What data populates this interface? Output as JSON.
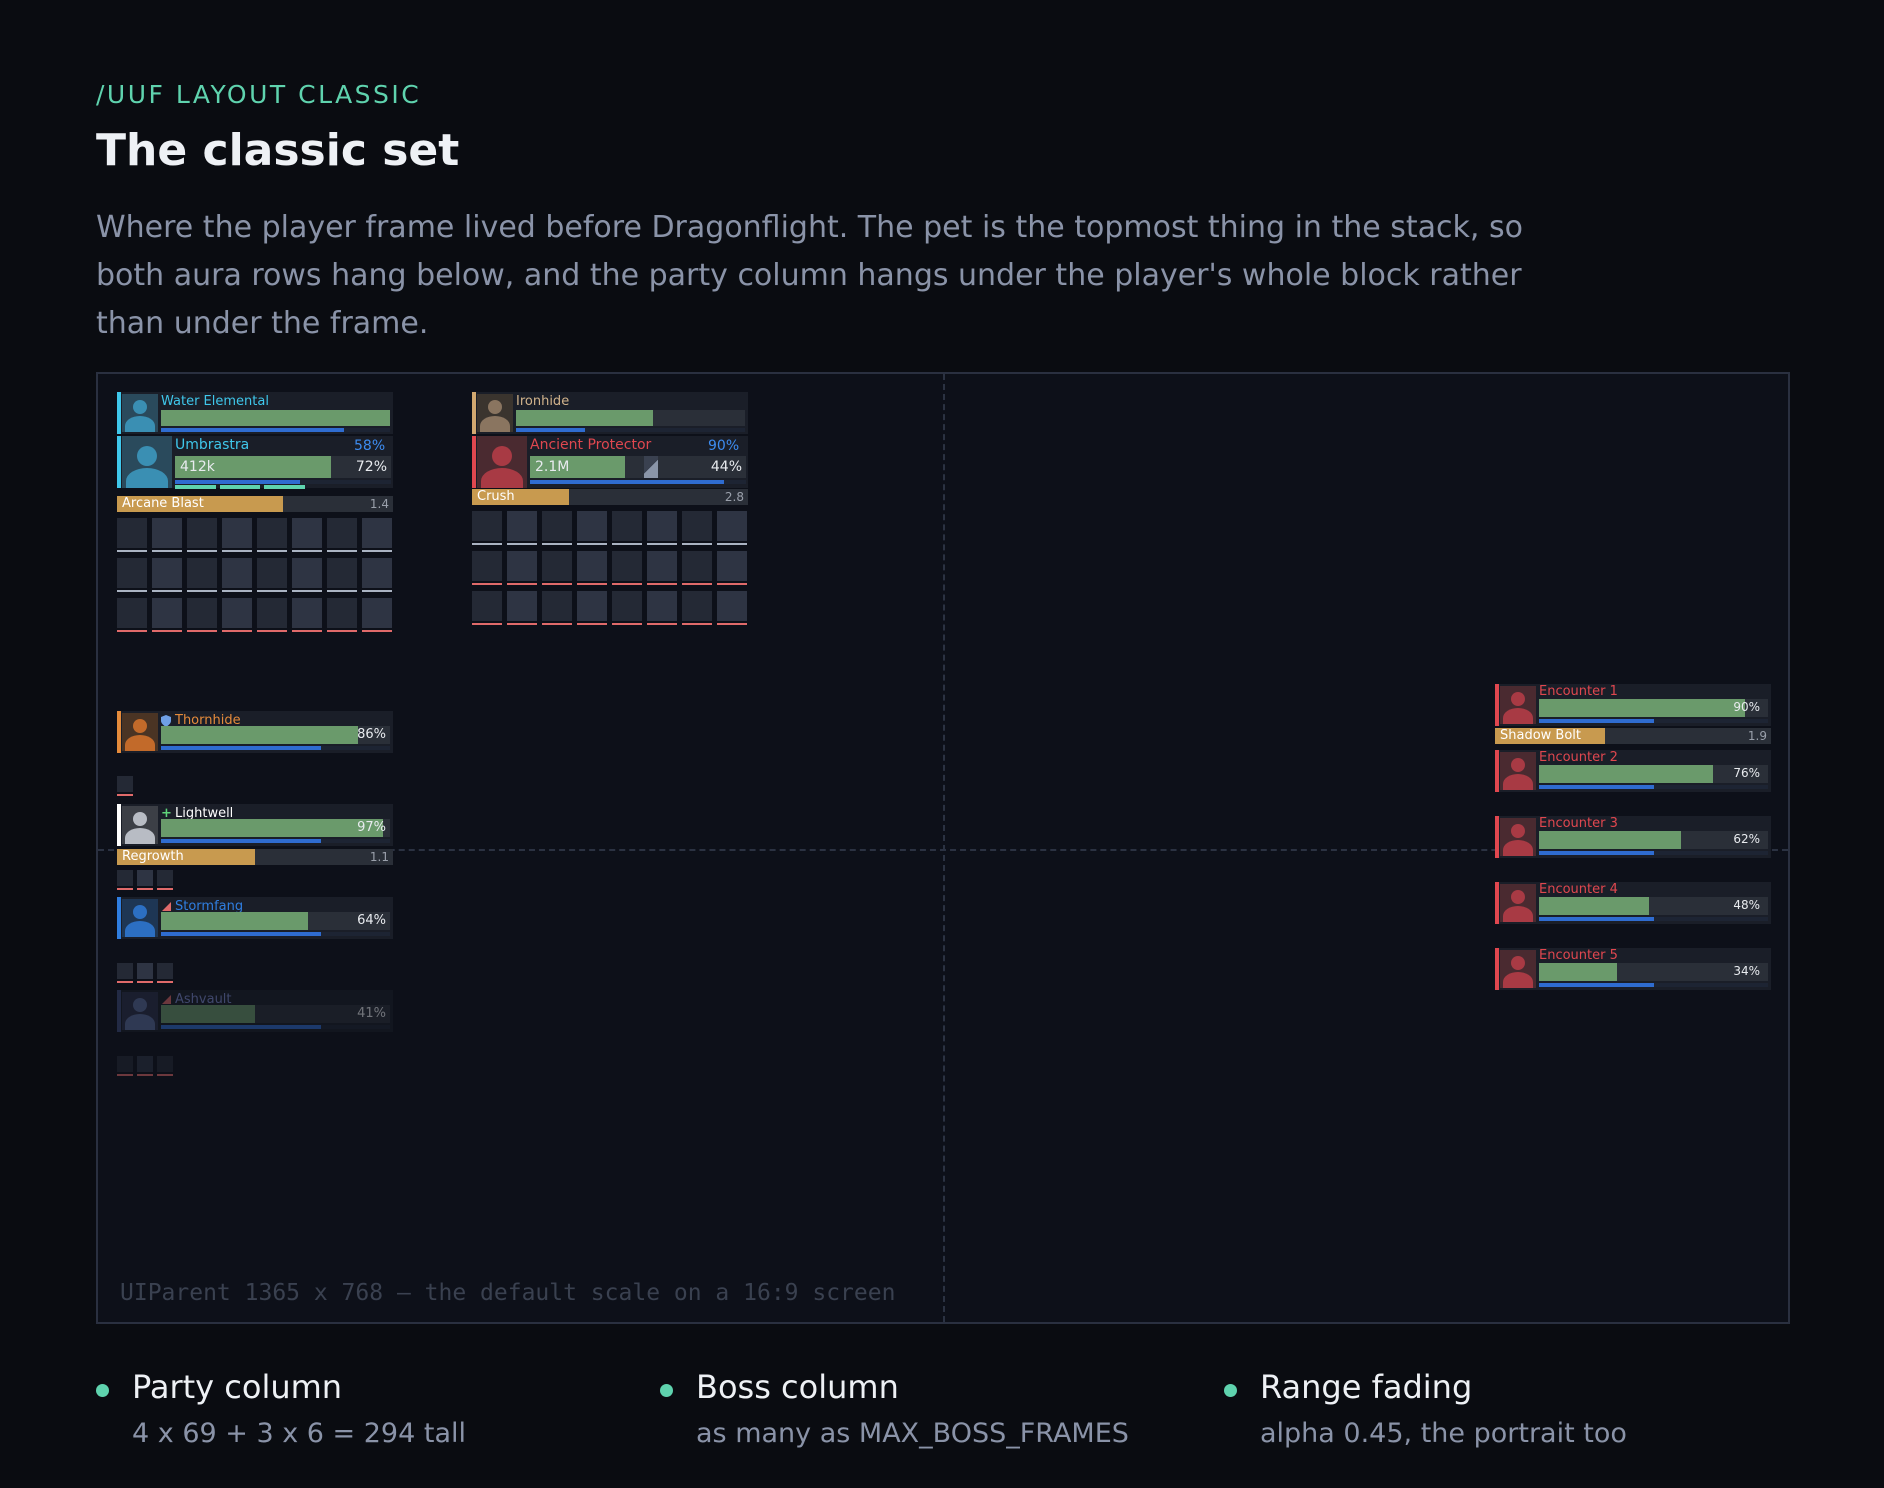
{
  "header": {
    "command": "/UUF LAYOUT CLASSIC",
    "title": "The classic set",
    "description": "Where the player frame lived before Dragonflight. The pet is the topmost thing in the stack, so both aura rows hang below, and the party column hangs under the player's whole block rather than under the frame."
  },
  "stage": {
    "caption": "UIParent 1365 x 768 — the default scale on a 16:9 screen"
  },
  "player_block": {
    "pet": {
      "name": "Water Elemental",
      "health_fraction": 1.0,
      "power_fraction": 0.8
    },
    "player": {
      "name": "Umbrastra",
      "power_percent": "58%",
      "health_text": "412k",
      "health_percent": "72%",
      "health_fraction": 0.72,
      "power_fraction": 0.58
    },
    "castbar": {
      "spell": "Arcane Blast",
      "time": "1.4",
      "progress": 0.6
    }
  },
  "target_block": {
    "target_of_target": {
      "name": "Ironhide",
      "health_fraction": 0.6,
      "power_fraction": 0.3
    },
    "target": {
      "name": "Ancient Protector",
      "power_percent": "90%",
      "health_text": "2.1M",
      "health_percent": "44%",
      "health_fraction": 0.44,
      "power_fraction": 0.9
    },
    "castbar": {
      "spell": "Crush",
      "time": "2.8",
      "progress": 0.35
    }
  },
  "party": [
    {
      "name": "Thornhide",
      "role_icon": "shield-icon",
      "health_percent": "86%",
      "health_fraction": 0.86,
      "power_fraction": 0.7,
      "color": "#e58b3b"
    },
    {
      "name": "Lightwell",
      "role_icon": "plus-icon",
      "health_percent": "97%",
      "health_fraction": 0.97,
      "power_fraction": 0.7,
      "color": "#ffffff",
      "castbar": {
        "spell": "Regrowth",
        "time": "1.1",
        "progress": 0.5
      }
    },
    {
      "name": "Stormfang",
      "role_icon": "sword-icon",
      "health_percent": "64%",
      "health_fraction": 0.64,
      "power_fraction": 0.7,
      "color": "#2f7ee0"
    },
    {
      "name": "Ashvault",
      "role_icon": "sword-icon",
      "health_percent": "41%",
      "health_fraction": 0.41,
      "power_fraction": 0.7,
      "color": "#3d4a7a",
      "faded": true
    }
  ],
  "bosses": [
    {
      "name": "Encounter 1",
      "health_percent": "90%",
      "health_fraction": 0.9,
      "castbar": {
        "spell": "Shadow Bolt",
        "time": "1.9",
        "progress": 0.4
      }
    },
    {
      "name": "Encounter 2",
      "health_percent": "76%",
      "health_fraction": 0.76
    },
    {
      "name": "Encounter 3",
      "health_percent": "62%",
      "health_fraction": 0.62
    },
    {
      "name": "Encounter 4",
      "health_percent": "48%",
      "health_fraction": 0.48
    },
    {
      "name": "Encounter 5",
      "health_percent": "34%",
      "health_fraction": 0.34
    }
  ],
  "legend": [
    {
      "title": "Party column",
      "subtitle": "4 x 69 + 3 x 6 = 294 tall"
    },
    {
      "title": "Boss column",
      "subtitle": "as many as MAX_BOSS_FRAMES"
    },
    {
      "title": "Range fading",
      "subtitle": "alpha 0.45, the portrait too"
    }
  ],
  "colors": {
    "accent": "#5fd3ae",
    "health": "#6a9a6b",
    "power": "#2f6cd0",
    "cast": "#c89a4f",
    "hostile": "#e0474f",
    "mage": "#3fc7eb"
  }
}
